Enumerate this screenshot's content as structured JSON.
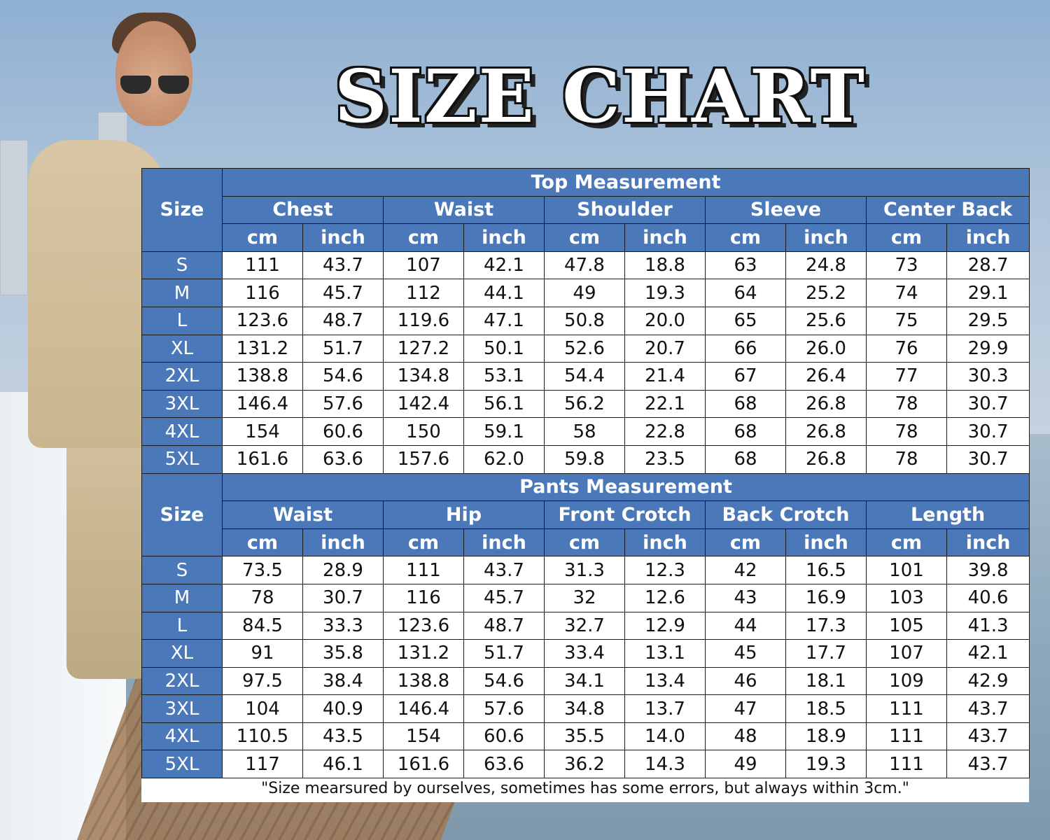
{
  "title": "SIZE CHART",
  "colors": {
    "header_blue": "#4a78b8",
    "border": "#1a1a1a"
  },
  "size_label": "Size",
  "units": [
    "cm",
    "inch"
  ],
  "top": {
    "title": "Top Measurement",
    "groups": [
      "Chest",
      "Waist",
      "Shoulder",
      "Sleeve",
      "Center Back"
    ],
    "rows": [
      [
        "S",
        "111",
        "43.7",
        "107",
        "42.1",
        "47.8",
        "18.8",
        "63",
        "24.8",
        "73",
        "28.7"
      ],
      [
        "M",
        "116",
        "45.7",
        "112",
        "44.1",
        "49",
        "19.3",
        "64",
        "25.2",
        "74",
        "29.1"
      ],
      [
        "L",
        "123.6",
        "48.7",
        "119.6",
        "47.1",
        "50.8",
        "20.0",
        "65",
        "25.6",
        "75",
        "29.5"
      ],
      [
        "XL",
        "131.2",
        "51.7",
        "127.2",
        "50.1",
        "52.6",
        "20.7",
        "66",
        "26.0",
        "76",
        "29.9"
      ],
      [
        "2XL",
        "138.8",
        "54.6",
        "134.8",
        "53.1",
        "54.4",
        "21.4",
        "67",
        "26.4",
        "77",
        "30.3"
      ],
      [
        "3XL",
        "146.4",
        "57.6",
        "142.4",
        "56.1",
        "56.2",
        "22.1",
        "68",
        "26.8",
        "78",
        "30.7"
      ],
      [
        "4XL",
        "154",
        "60.6",
        "150",
        "59.1",
        "58",
        "22.8",
        "68",
        "26.8",
        "78",
        "30.7"
      ],
      [
        "5XL",
        "161.6",
        "63.6",
        "157.6",
        "62.0",
        "59.8",
        "23.5",
        "68",
        "26.8",
        "78",
        "30.7"
      ]
    ]
  },
  "pants": {
    "title": "Pants Measurement",
    "groups": [
      "Waist",
      "Hip",
      "Front Crotch",
      "Back Crotch",
      "Length"
    ],
    "rows": [
      [
        "S",
        "73.5",
        "28.9",
        "111",
        "43.7",
        "31.3",
        "12.3",
        "42",
        "16.5",
        "101",
        "39.8"
      ],
      [
        "M",
        "78",
        "30.7",
        "116",
        "45.7",
        "32",
        "12.6",
        "43",
        "16.9",
        "103",
        "40.6"
      ],
      [
        "L",
        "84.5",
        "33.3",
        "123.6",
        "48.7",
        "32.7",
        "12.9",
        "44",
        "17.3",
        "105",
        "41.3"
      ],
      [
        "XL",
        "91",
        "35.8",
        "131.2",
        "51.7",
        "33.4",
        "13.1",
        "45",
        "17.7",
        "107",
        "42.1"
      ],
      [
        "2XL",
        "97.5",
        "38.4",
        "138.8",
        "54.6",
        "34.1",
        "13.4",
        "46",
        "18.1",
        "109",
        "42.9"
      ],
      [
        "3XL",
        "104",
        "40.9",
        "146.4",
        "57.6",
        "34.8",
        "13.7",
        "47",
        "18.5",
        "111",
        "43.7"
      ],
      [
        "4XL",
        "110.5",
        "43.5",
        "154",
        "60.6",
        "35.5",
        "14.0",
        "48",
        "18.9",
        "111",
        "43.7"
      ],
      [
        "5XL",
        "117",
        "46.1",
        "161.6",
        "63.6",
        "36.2",
        "14.3",
        "49",
        "19.3",
        "111",
        "43.7"
      ]
    ]
  },
  "note": "\"Size mearsured by ourselves, sometimes has some errors, but always within 3cm.\""
}
